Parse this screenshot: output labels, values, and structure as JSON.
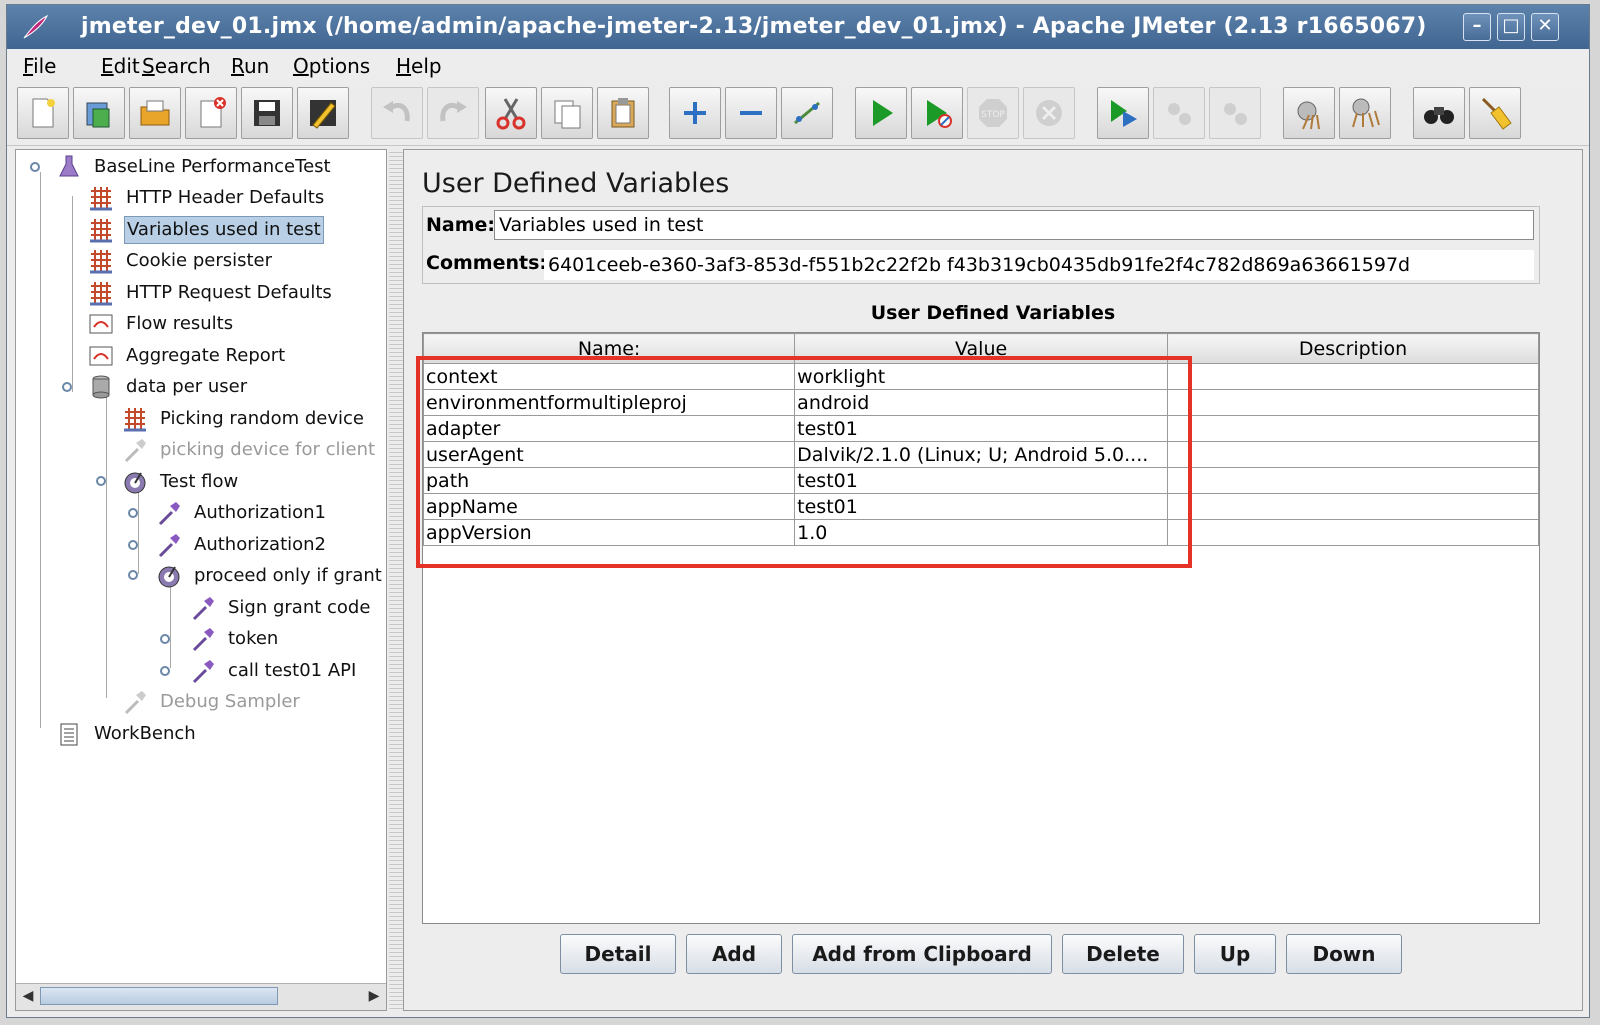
{
  "window": {
    "title": "jmeter_dev_01.jmx (/home/admin/apache-jmeter-2.13/jmeter_dev_01.jmx) - Apache JMeter (2.13 r1665067)",
    "controls": [
      "minimize-icon",
      "maximize-icon",
      "close-icon"
    ]
  },
  "menu": [
    "File",
    "Edit",
    "Search",
    "Run",
    "Options",
    "Help"
  ],
  "toolbar": [
    {
      "name": "new-icon",
      "enabled": true
    },
    {
      "name": "templates-icon",
      "enabled": true
    },
    {
      "name": "open-icon",
      "enabled": true
    },
    {
      "name": "close-file-icon",
      "enabled": true
    },
    {
      "name": "save-icon",
      "enabled": true
    },
    {
      "name": "save-as-icon",
      "enabled": true
    },
    {
      "name": "undo-icon",
      "enabled": false
    },
    {
      "name": "redo-icon",
      "enabled": false
    },
    {
      "name": "cut-icon",
      "enabled": true
    },
    {
      "name": "copy-icon",
      "enabled": true
    },
    {
      "name": "paste-icon",
      "enabled": true
    },
    {
      "name": "expand-icon",
      "enabled": true
    },
    {
      "name": "collapse-icon",
      "enabled": true
    },
    {
      "name": "toggle-icon",
      "enabled": true
    },
    {
      "name": "start-icon",
      "enabled": true
    },
    {
      "name": "start-no-timers-icon",
      "enabled": true
    },
    {
      "name": "stop-icon",
      "enabled": false
    },
    {
      "name": "shutdown-icon",
      "enabled": false
    },
    {
      "name": "remote-start-icon",
      "enabled": true
    },
    {
      "name": "remote-stop-icon",
      "enabled": false
    },
    {
      "name": "remote-shutdown-icon",
      "enabled": false
    },
    {
      "name": "clear-icon",
      "enabled": true
    },
    {
      "name": "clear-all-icon",
      "enabled": true
    },
    {
      "name": "search-icon",
      "enabled": true
    },
    {
      "name": "reset-search-icon",
      "enabled": true
    }
  ],
  "tree": [
    {
      "label": "BaseLine PerformanceTest",
      "icon": "test-plan-icon",
      "depth": 0
    },
    {
      "label": "HTTP Header Defaults",
      "icon": "config-element-icon",
      "depth": 1
    },
    {
      "label": "Variables used in test",
      "icon": "config-element-icon",
      "depth": 1,
      "selected": true
    },
    {
      "label": "Cookie persister",
      "icon": "config-element-icon",
      "depth": 1
    },
    {
      "label": "HTTP Request Defaults",
      "icon": "config-element-icon",
      "depth": 1
    },
    {
      "label": "Flow results",
      "icon": "listener-icon",
      "depth": 1
    },
    {
      "label": "Aggregate Report",
      "icon": "listener-icon",
      "depth": 1
    },
    {
      "label": "data per  user",
      "icon": "thread-group-icon",
      "depth": 1
    },
    {
      "label": "Picking random device",
      "icon": "config-element-icon",
      "depth": 2
    },
    {
      "label": "picking device for client",
      "icon": "sampler-icon",
      "depth": 2,
      "disabled": true
    },
    {
      "label": "Test flow",
      "icon": "controller-icon",
      "depth": 2
    },
    {
      "label": "Authorization1",
      "icon": "sampler-icon",
      "depth": 3
    },
    {
      "label": "Authorization2",
      "icon": "sampler-icon",
      "depth": 3
    },
    {
      "label": "proceed only if  grant",
      "icon": "controller-icon",
      "depth": 3
    },
    {
      "label": "Sign grant code",
      "icon": "sampler-icon",
      "depth": 4
    },
    {
      "label": "token",
      "icon": "sampler-icon",
      "depth": 4
    },
    {
      "label": "call test01 API",
      "icon": "sampler-icon",
      "depth": 4
    },
    {
      "label": "Debug Sampler",
      "icon": "sampler-icon",
      "depth": 2,
      "disabled": true
    },
    {
      "label": "WorkBench",
      "icon": "workbench-icon",
      "depth": 0
    }
  ],
  "panel": {
    "heading": "User Defined Variables",
    "name_label": "Name:",
    "name_value": "Variables used in test",
    "comments_label": "Comments:",
    "comments_value": "6401ceeb-e360-3af3-853d-f551b2c22f2b  f43b319cb0435db91fe2f4c782d869a63661597d",
    "table_title": "User Defined Variables",
    "columns": [
      "Name:",
      "Value",
      "Description"
    ],
    "rows": [
      [
        "context",
        "worklight",
        ""
      ],
      [
        "environmentformultipleproj",
        "android",
        ""
      ],
      [
        "adapter",
        "test01",
        ""
      ],
      [
        "userAgent",
        "Dalvik/2.1.0 (Linux; U; Android 5.0....",
        ""
      ],
      [
        "path",
        "test01",
        ""
      ],
      [
        "appName",
        "test01",
        ""
      ],
      [
        "appVersion",
        "1.0",
        ""
      ]
    ]
  },
  "buttons": [
    "Detail",
    "Add",
    "Add from Clipboard",
    "Delete",
    "Up",
    "Down"
  ],
  "colors": {
    "titlebar": "#4a7099",
    "highlight": "#e53227",
    "selection": "#b8cfe5"
  }
}
